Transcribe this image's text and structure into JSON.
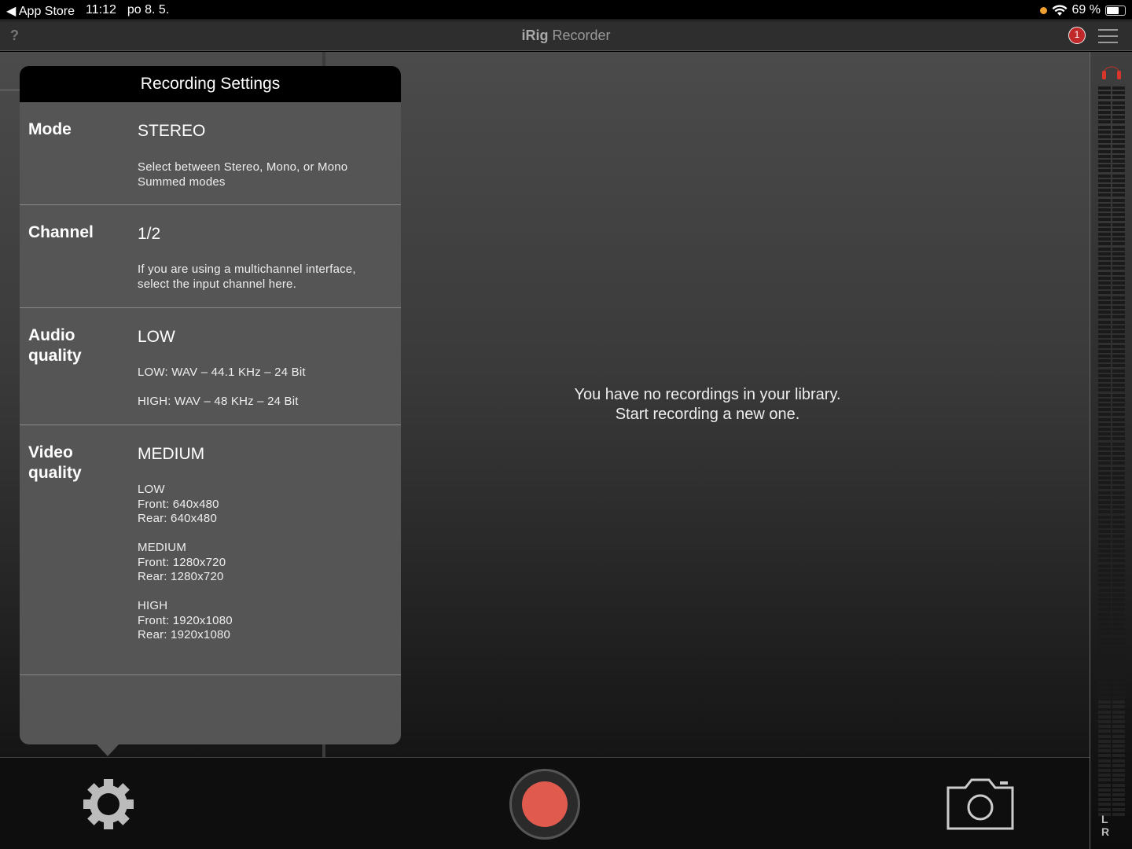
{
  "status_bar": {
    "back": "◀ App Store",
    "time": "11:12",
    "date": "po 8. 5.",
    "battery": "69 %",
    "battery_level": 0.69
  },
  "nav": {
    "help": "?",
    "title_bold": "iRig",
    "title_rest": " Recorder",
    "badge": "1"
  },
  "library": {
    "empty_line1": "You have no recordings in your library.",
    "empty_line2": "Start recording a new one."
  },
  "meter": {
    "label": "L R"
  },
  "popover": {
    "title": "Recording Settings",
    "sections": [
      {
        "label": "Mode",
        "value": "STEREO",
        "desc": "Select between Stereo, Mono, or Mono\nSummed modes"
      },
      {
        "label": "Channel",
        "value": "1/2",
        "desc": "If you are using a multichannel interface,\nselect the input channel here."
      },
      {
        "label": "Audio quality",
        "value": "LOW",
        "desc": "LOW: WAV – 44.1 KHz – 24 Bit\n\nHIGH: WAV – 48 KHz – 24 Bit"
      },
      {
        "label": "Video quality",
        "value": "MEDIUM",
        "desc": "LOW\nFront: 640x480\nRear: 640x480\n\nMEDIUM\nFront: 1280x720\nRear: 1280x720\n\nHIGH\nFront: 1920x1080\nRear: 1920x1080"
      }
    ]
  }
}
